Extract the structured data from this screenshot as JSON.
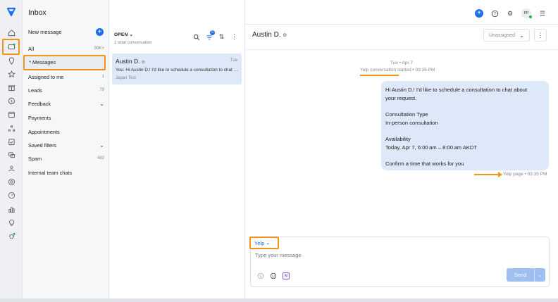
{
  "rail": {
    "icons": [
      "logo",
      "home-icon",
      "inbox-icon",
      "location-icon",
      "star-icon",
      "gift-icon",
      "dollar-icon",
      "calendar-icon",
      "network-icon",
      "task-icon",
      "chat-bubbles-icon",
      "contacts-icon",
      "target-icon",
      "dashboard-icon",
      "reports-icon",
      "lightbulb-icon",
      "settings-badge-icon"
    ]
  },
  "inbox": {
    "title": "Inbox",
    "new_message": "New message",
    "items": [
      {
        "label": "All",
        "count": "99K+"
      },
      {
        "label": "* Messages",
        "count": ""
      },
      {
        "label": "Assigned to me",
        "count": "1"
      },
      {
        "label": "Leads",
        "count": "79"
      },
      {
        "label": "Feedback",
        "count": ""
      },
      {
        "label": "Payments",
        "count": ""
      },
      {
        "label": "Appointments",
        "count": ""
      },
      {
        "label": "Saved filters",
        "count": ""
      },
      {
        "label": "Spam",
        "count": "482"
      },
      {
        "label": "Internal team chats",
        "count": ""
      }
    ]
  },
  "conversations": {
    "filter_label": "OPEN",
    "total": "1 total conversation",
    "filter_badge": "5",
    "items": [
      {
        "name": "Austin D.",
        "time": "Tue",
        "preview": "You: Hi Austin D.! I'd like to schedule a consultation to chat about your request.",
        "location": "Japan Test"
      }
    ]
  },
  "topbar": {
    "avatar_initials": "PP"
  },
  "chat": {
    "contact_name": "Austin D.",
    "assignee": "Unassigned",
    "day_stamp": "Tue • Apr 7",
    "started_link": "Yelp conversation",
    "started_rest": " started • 03:35 PM",
    "message_lines": [
      "Hi Austin D.! I'd like to schedule a consultation to chat about",
      "your request.",
      "",
      "Consultation Type",
      "In-person consultation",
      "",
      "Availability",
      "Today, Apr 7, 6:00 am – 8:00 am AKDT",
      "",
      "Confirm a time that works for you"
    ],
    "message_meta": "Yelp page • 03:35 PM"
  },
  "composer": {
    "channel": "Yelp",
    "placeholder": "Type your message",
    "send_label": "Send",
    "ai_label": "AI"
  }
}
